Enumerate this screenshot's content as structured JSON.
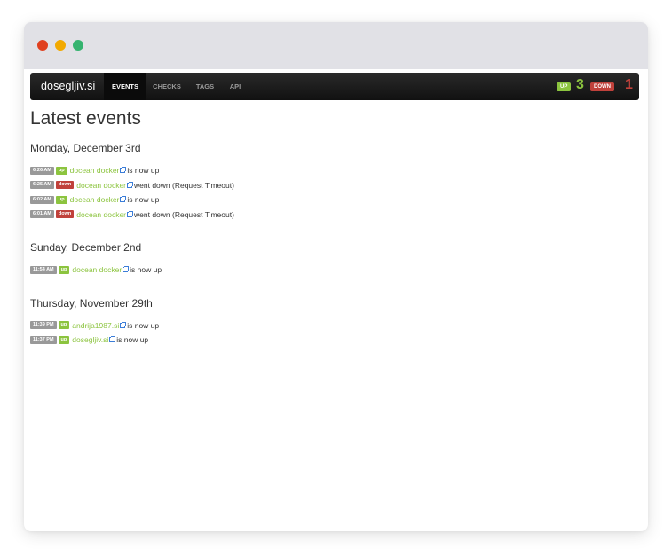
{
  "navbar": {
    "brand": "dosegljiv.si",
    "items": [
      {
        "label": "EVENTS",
        "active": true
      },
      {
        "label": "CHECKS",
        "active": false
      },
      {
        "label": "TAGS",
        "active": false
      },
      {
        "label": "API",
        "active": false
      }
    ],
    "up_label": "UP",
    "up_count": "3",
    "down_label": "DOWN",
    "down_count": "1"
  },
  "page": {
    "title": "Latest events"
  },
  "days": [
    {
      "date": "Monday, December 3rd",
      "events": [
        {
          "time": "6:26 AM",
          "status": "up",
          "name": "docean docker",
          "message": "is now up"
        },
        {
          "time": "6:25 AM",
          "status": "down",
          "name": "docean docker",
          "message": "went down (Request Timeout)"
        },
        {
          "time": "6:02 AM",
          "status": "up",
          "name": "docean docker",
          "message": "is now up"
        },
        {
          "time": "6:01 AM",
          "status": "down",
          "name": "docean docker",
          "message": "went down (Request Timeout)"
        }
      ]
    },
    {
      "date": "Sunday, December 2nd",
      "events": [
        {
          "time": "11:54 AM",
          "status": "up",
          "name": "docean docker",
          "message": "is now up"
        }
      ]
    },
    {
      "date": "Thursday, November 29th",
      "events": [
        {
          "time": "11:39 PM",
          "status": "up",
          "name": "andrija1987.si",
          "message": "is now up"
        },
        {
          "time": "11:37 PM",
          "status": "up",
          "name": "dosegljiv.si",
          "message": "is now up"
        }
      ]
    }
  ],
  "colors": {
    "up": "#8cc43f",
    "down": "#c0413b",
    "external_link_icon": "#3b7dd8"
  },
  "icons": {
    "external_link": "external-link-icon"
  }
}
